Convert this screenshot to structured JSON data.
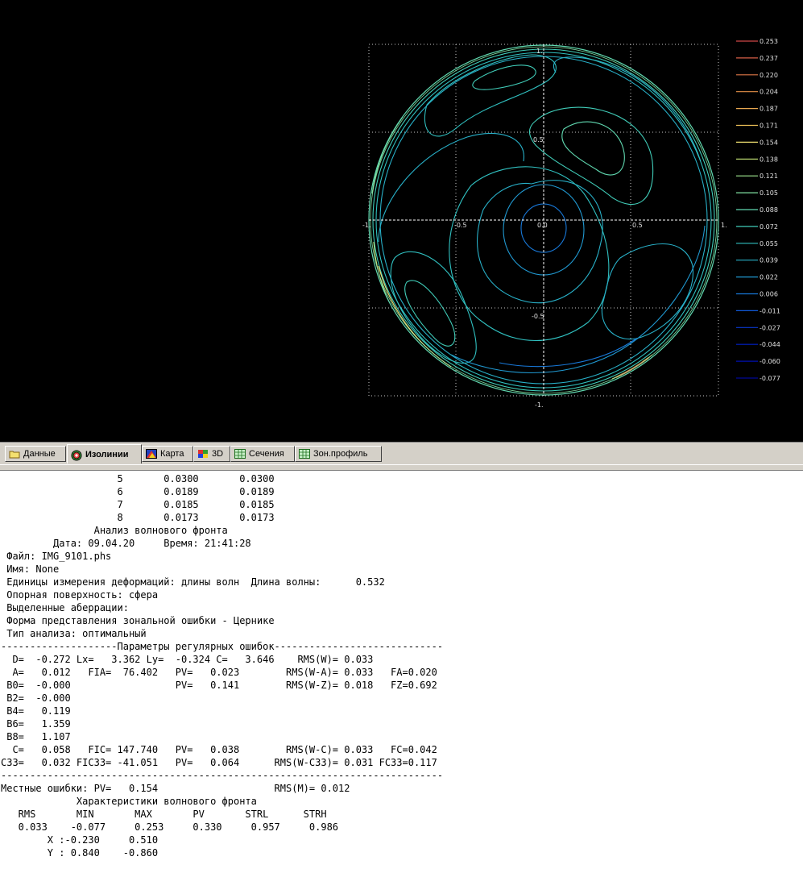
{
  "plot": {
    "axis_labels": {
      "x_neg1": "-1.",
      "x_neg05": "-0.5",
      "x_0": "0.0",
      "x_05": "0.5",
      "x_1": "1.",
      "y_1": "1.",
      "y_05": "0.5",
      "y_neg05": "-0.5",
      "y_neg1": "-1."
    },
    "legend": [
      {
        "value": "0.253",
        "color": "#d04848"
      },
      {
        "value": "0.237",
        "color": "#d86048"
      },
      {
        "value": "0.220",
        "color": "#e07848"
      },
      {
        "value": "0.204",
        "color": "#e49048"
      },
      {
        "value": "0.187",
        "color": "#e8a850"
      },
      {
        "value": "0.171",
        "color": "#ecc058"
      },
      {
        "value": "0.154",
        "color": "#f0e070"
      },
      {
        "value": "0.138",
        "color": "#c8e878"
      },
      {
        "value": "0.121",
        "color": "#a0e890"
      },
      {
        "value": "0.105",
        "color": "#80e0a0"
      },
      {
        "value": "0.088",
        "color": "#60d8b0"
      },
      {
        "value": "0.072",
        "color": "#40ccb8"
      },
      {
        "value": "0.055",
        "color": "#30c0c0"
      },
      {
        "value": "0.039",
        "color": "#28b0c8"
      },
      {
        "value": "0.022",
        "color": "#2098d0"
      },
      {
        "value": "0.006",
        "color": "#1878d8"
      },
      {
        "value": "-0.011",
        "color": "#1058d8"
      },
      {
        "value": "-0.027",
        "color": "#0838d0"
      },
      {
        "value": "-0.044",
        "color": "#0020c8"
      },
      {
        "value": "-0.060",
        "color": "#0010b0"
      },
      {
        "value": "-0.077",
        "color": "#000898"
      }
    ]
  },
  "tabs": [
    {
      "label": "Данные",
      "icon": "folder-icon"
    },
    {
      "label": "Изолинии",
      "icon": "target-icon"
    },
    {
      "label": "Карта",
      "icon": "map-icon"
    },
    {
      "label": "3D",
      "icon": "3d-icon"
    },
    {
      "label": "Сечения",
      "icon": "grid-chart-icon"
    },
    {
      "label": "Зон.профиль",
      "icon": "grid-chart-icon"
    }
  ],
  "report_lines": [
    "                    5       0.0300       0.0300",
    "                    6       0.0189       0.0189",
    "                    7       0.0185       0.0185",
    "                    8       0.0173       0.0173",
    "                Анализ волнового фронта",
    "         Дата: 09.04.20     Время: 21:41:28",
    " Файл: IMG_9101.phs",
    " Имя: None",
    " Единицы измерения деформаций: длины волн  Длина волны:      0.532",
    " Опорная поверхность: сфера",
    " Выделенные аберрации:",
    " Форма представления зональной ошибки - Цернике",
    " Тип анализа: оптимальный",
    "--------------------Параметры регулярных ошибок-----------------------------",
    "  D=  -0.272 Lx=   3.362 Ly=  -0.324 C=   3.646    RMS(W)= 0.033",
    "  A=   0.012   FIA=  76.402   PV=   0.023        RMS(W-A)= 0.033   FA=0.020",
    " B0=  -0.000                  PV=   0.141        RMS(W-Z)= 0.018   FZ=0.692",
    " B2=  -0.000",
    " B4=   0.119",
    " B6=   1.359",
    " B8=   1.107",
    "  C=   0.058   FIC= 147.740   PV=   0.038        RMS(W-C)= 0.033   FC=0.042",
    "C33=   0.032 FIC33= -41.051   PV=   0.064      RMS(W-C33)= 0.031 FC33=0.117",
    "----------------------------------------------------------------------------",
    "Местные ошибки: PV=   0.154                    RMS(M)= 0.012",
    "             Характеристики волнового фронта",
    "   RMS       MIN       MAX       PV       STRL      STRH",
    "   0.033    -0.077     0.253     0.330     0.957     0.986",
    "        X :-0.230     0.510",
    "        Y : 0.840    -0.860"
  ]
}
